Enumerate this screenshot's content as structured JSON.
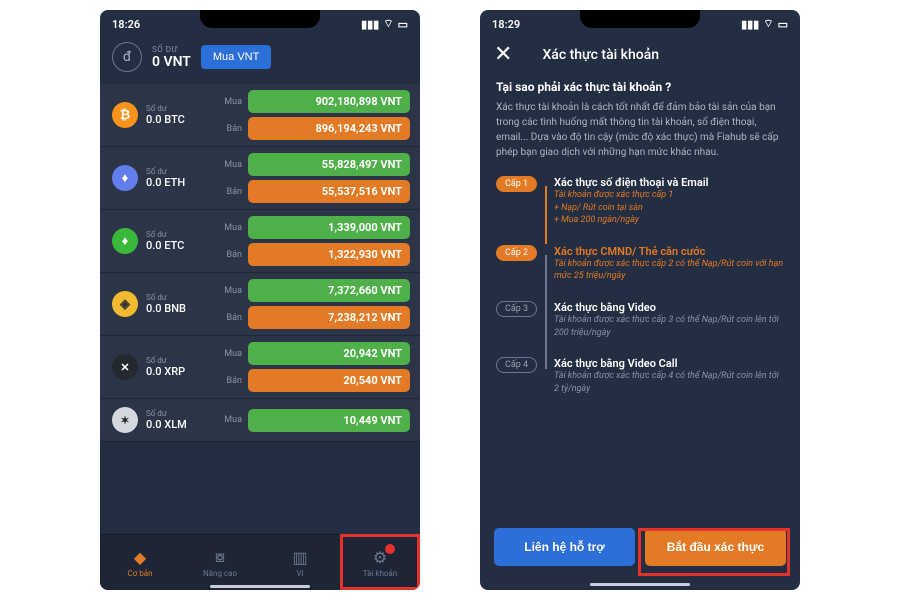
{
  "screen1": {
    "status_time": "18:26",
    "balance_label": "SỐ DƯ",
    "balance_value": "0 VNT",
    "buy_vnt_label": "Mua VNT",
    "balance_word": "Số dư",
    "buy_lbl": "Mua",
    "sell_lbl": "Bán",
    "coins": [
      {
        "icon": "₿",
        "cls": "ic-btc",
        "symbol": "0.0 BTC",
        "buy": "902,180,898 VNT",
        "sell": "896,194,243 VNT"
      },
      {
        "icon": "♦",
        "cls": "ic-eth",
        "symbol": "0.0 ETH",
        "buy": "55,828,497 VNT",
        "sell": "55,537,516 VNT"
      },
      {
        "icon": "♦",
        "cls": "ic-etc",
        "symbol": "0.0 ETC",
        "buy": "1,339,000 VNT",
        "sell": "1,322,930 VNT"
      },
      {
        "icon": "◈",
        "cls": "ic-bnb",
        "symbol": "0.0 BNB",
        "buy": "7,372,660 VNT",
        "sell": "7,238,212 VNT"
      },
      {
        "icon": "✕",
        "cls": "ic-xrp",
        "symbol": "0.0 XRP",
        "buy": "20,942 VNT",
        "sell": "20,540 VNT"
      },
      {
        "icon": "✶",
        "cls": "ic-xlm",
        "symbol": "0.0 XLM",
        "buy": "10,449 VNT",
        "sell": ""
      }
    ],
    "tabs": [
      {
        "label": "Cơ bản",
        "icon": "◆"
      },
      {
        "label": "Nâng cao",
        "icon": "⧇"
      },
      {
        "label": "Ví",
        "icon": "▥"
      },
      {
        "label": "Tài khoản",
        "icon": "⚙"
      }
    ]
  },
  "screen2": {
    "status_time": "18:29",
    "title": "Xác thực tài khoản",
    "question": "Tại sao phải xác thực tài khoản ?",
    "explain": "Xác thực tài khoản là cách tốt nhất để đảm bảo tài sản của bạn trong các tình huống mất thông tin tài khoản, số điện thoại, email... Dựa vào độ tin cậy (mức độ xác thực) mà Fiahub sẽ cấp phép bạn giao dịch với những hạn mức khác nhau.",
    "levels": [
      {
        "badge": "Cấp 1",
        "title": "Xác thực số điện thoại và Email",
        "desc": "Tài khoản được xác thực cấp 1\n+ Nạp/ Rút coin tại sàn\n+ Mua 200 ngàn/ngày",
        "active": true
      },
      {
        "badge": "Cấp 2",
        "title": "Xác thực CMND/ Thẻ căn cước",
        "desc": "Tài khoản được xác thực cấp 2 có thể Nạp/Rút coin với hạn mức 25 triệu/ngày",
        "active": true
      },
      {
        "badge": "Cấp 3",
        "title": "Xác thực bằng Video",
        "desc": "Tài khoản được xác thực cấp 3 có thể Nạp/Rút coin lên tới 200 triệu/ngày",
        "active": false
      },
      {
        "badge": "Cấp 4",
        "title": "Xác thực bằng Video Call",
        "desc": "Tài khoản được xác thực cấp 4 có thể Nạp/Rút coin lên tới 2 tỷ/ngày",
        "active": false
      }
    ],
    "support_btn": "Liên hệ hỗ trợ",
    "start_btn": "Bắt đầu xác thực"
  }
}
